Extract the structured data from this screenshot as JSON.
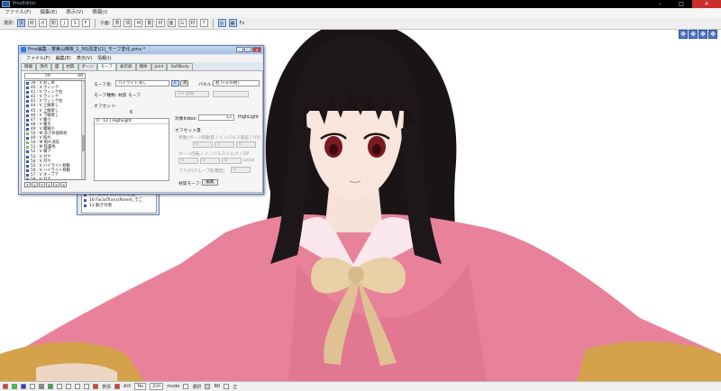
{
  "app": {
    "title": "PmxEditor",
    "menu": [
      "ファイル(F)",
      "編集(E)",
      "表示(V)",
      "情報(I)"
    ],
    "toolbar_items": [
      "選択:",
      "頂",
      "材",
      "ボ",
      "剛",
      "J",
      "S",
      "F",
      "子面:",
      "表",
      "情",
      "M",
      "動",
      "材",
      "面",
      "G",
      "材",
      "T",
      "Fx"
    ]
  },
  "morph_window": {
    "title": "Pmx編集 - 蓬莱山輝夜_1_30(改変)(1)_モーフ変化.pmx *",
    "menu": [
      "ファイル(F)",
      "編集(E)",
      "表示(V)",
      "情報(I)"
    ],
    "tabs": [
      "情報",
      "頂点",
      "面",
      "材質",
      "ボーン",
      "モーフ",
      "表示枠",
      "剛体",
      "Joint",
      "SoftBody"
    ],
    "active_tab": "モーフ",
    "list_header": {
      "index": "59",
      "count": "69"
    },
    "morph_list": [
      {
        "n": "39",
        "p": "V",
        "name": "おこめ",
        "g": false
      },
      {
        "n": "40",
        "p": "V",
        "name": "ウィンク",
        "g": false
      },
      {
        "n": "41",
        "p": "V",
        "name": "ウィンク右",
        "g": false
      },
      {
        "n": "42",
        "p": "V",
        "name": "ウィンク",
        "g": false
      },
      {
        "n": "43",
        "p": "V",
        "name": "ウィンク右",
        "g": false
      },
      {
        "n": "44",
        "p": "V",
        "name": "上瞼寄し",
        "g": false
      },
      {
        "n": "45",
        "p": "V",
        "name": "上瞼寄し",
        "g": false
      },
      {
        "n": "46",
        "p": "V",
        "name": "下瞼寄し",
        "g": false
      },
      {
        "n": "47",
        "p": "V",
        "name": "瞳小",
        "g": false
      },
      {
        "n": "48",
        "p": "V",
        "name": "瞳大",
        "g": false
      },
      {
        "n": "49",
        "p": "V",
        "name": "瞳縮小",
        "g": false
      },
      {
        "n": "50",
        "p": "M",
        "name": "あさめ面照射",
        "g": true
      },
      {
        "n": "49",
        "p": "V",
        "name": "照れ",
        "g": false
      },
      {
        "n": "50",
        "p": "M",
        "name": "照れ消去",
        "g": true
      },
      {
        "n": "51",
        "p": "M",
        "name": "猛裏色",
        "g": true
      },
      {
        "n": "52",
        "p": "V",
        "name": "横ア",
        "g": false
      },
      {
        "n": "53",
        "p": "V",
        "name": "ガナ",
        "g": false
      },
      {
        "n": "54",
        "p": "V",
        "name": "月ヤ",
        "g": false
      },
      {
        "n": "55",
        "p": "V",
        "name": "ハイライト移動",
        "g": false
      },
      {
        "n": "56",
        "p": "V",
        "name": "ハイライト移動",
        "g": false
      },
      {
        "n": "57",
        "p": "V",
        "name": "オープア",
        "g": false
      },
      {
        "n": "58",
        "p": "V",
        "name": "ガナ",
        "g": false
      },
      {
        "n": "59",
        "p": "M",
        "name": "ハイライト消し",
        "g": true
      }
    ],
    "selected_index": 22,
    "form": {
      "morph_name_label": "モーフ名:",
      "morph_name_value": "ハイライト消し",
      "btn_e": "E",
      "btn_copy": "英",
      "panel_label": "パネル:",
      "panel_value": "右下(その他)",
      "morph_type_label": "モーフ種類: 材質 モーフ",
      "offset_label": "オフセット:",
      "offset_value": "6",
      "offset_header": "0 : 12 | HighLight",
      "offset_disabled": "<< 追加",
      "target_label": "対象Index:",
      "target_index": "12",
      "target_name": "HighLight",
      "offset_amount_label": "オフセット量",
      "row1": "移動(ボーン移動量 / インパルス速度 / UV)",
      "row2": "ボーン回転 / インパルストルク / UV",
      "local_label": "Local",
      "row3": "フラグ(グループ影響度)",
      "material_morph_label": "材質モーフ:",
      "edit_button": "編集",
      "zero": "0"
    },
    "list_buttons": [
      "↑",
      "↓",
      "⇑",
      "⇓",
      "+",
      "×"
    ]
  },
  "back_window": {
    "rows": [
      "15 FacialPoseParent_旋",
      "16 FacialTrans(Parent_でこ",
      "13 動き付者"
    ]
  },
  "statusbar": {
    "items": [
      "表情",
      "AIX",
      "No",
      "2ch",
      "mode",
      "選択",
      "BR",
      "正"
    ],
    "mode_value": "mode"
  },
  "colors": {
    "accent": "#3399ff",
    "dress": "#e8829a",
    "bow": "#e8cfa6",
    "hair": "#1b1416"
  }
}
